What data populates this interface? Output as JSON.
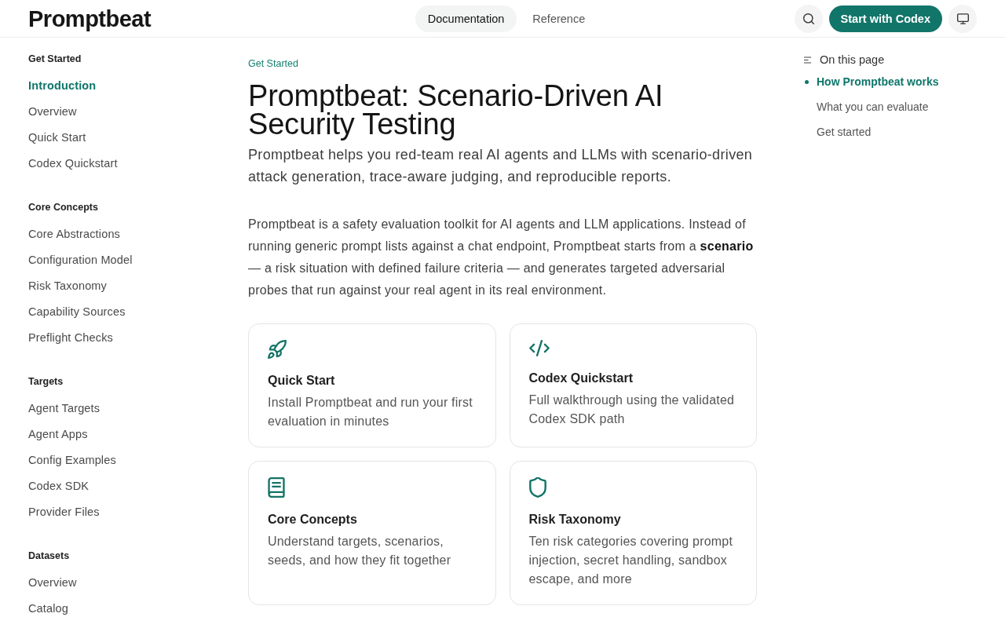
{
  "header": {
    "logo": "Promptbeat",
    "nav": [
      {
        "label": "Documentation",
        "selected": true
      },
      {
        "label": "Reference",
        "selected": false
      }
    ],
    "cta": "Start with Codex"
  },
  "sidebar": {
    "sections": [
      {
        "title": "Get Started",
        "items": [
          {
            "label": "Introduction",
            "selected": true
          },
          {
            "label": "Overview",
            "selected": false
          },
          {
            "label": "Quick Start",
            "selected": false
          },
          {
            "label": "Codex Quickstart",
            "selected": false
          }
        ]
      },
      {
        "title": "Core Concepts",
        "items": [
          {
            "label": "Core Abstractions",
            "selected": false
          },
          {
            "label": "Configuration Model",
            "selected": false
          },
          {
            "label": "Risk Taxonomy",
            "selected": false
          },
          {
            "label": "Capability Sources",
            "selected": false
          },
          {
            "label": "Preflight Checks",
            "selected": false
          }
        ]
      },
      {
        "title": "Targets",
        "items": [
          {
            "label": "Agent Targets",
            "selected": false
          },
          {
            "label": "Agent Apps",
            "selected": false
          },
          {
            "label": "Config Examples",
            "selected": false
          },
          {
            "label": "Codex SDK",
            "selected": false
          },
          {
            "label": "Provider Files",
            "selected": false
          }
        ]
      },
      {
        "title": "Datasets",
        "items": [
          {
            "label": "Overview",
            "selected": false
          },
          {
            "label": "Catalog",
            "selected": false
          }
        ]
      }
    ]
  },
  "main": {
    "breadcrumb": "Get Started",
    "title": "Promptbeat: Scenario-Driven AI Security Testing",
    "lead": "Promptbeat helps you red-team real AI agents and LLMs with scenario-driven attack generation, trace-aware judging, and reproducible reports.",
    "body": "Promptbeat is a safety evaluation toolkit for AI agents and LLM applications. Instead of running generic prompt lists against a chat endpoint, Promptbeat starts from a **scenario** — a risk situation with defined failure criteria — and generates targeted adversarial probes that run against your real agent in its real environment.",
    "cards": [
      {
        "kind": "rocket",
        "title": "Quick Start",
        "description": "Install Promptbeat and run your first evaluation in minutes"
      },
      {
        "kind": "code",
        "title": "Codex Quickstart",
        "description": "Full walkthrough using the validated Codex SDK path"
      },
      {
        "kind": "book",
        "title": "Core Concepts",
        "description": "Understand targets, scenarios, seeds, and how they fit together"
      },
      {
        "kind": "shield",
        "title": "Risk Taxonomy",
        "description": "Ten risk categories covering prompt injection, secret handling, sandbox escape, and more"
      }
    ]
  },
  "toc": {
    "title": "On this page",
    "items": [
      {
        "label": "How Promptbeat works",
        "selected": true
      },
      {
        "label": "What you can evaluate",
        "selected": false
      },
      {
        "label": "Get started",
        "selected": false
      }
    ]
  }
}
